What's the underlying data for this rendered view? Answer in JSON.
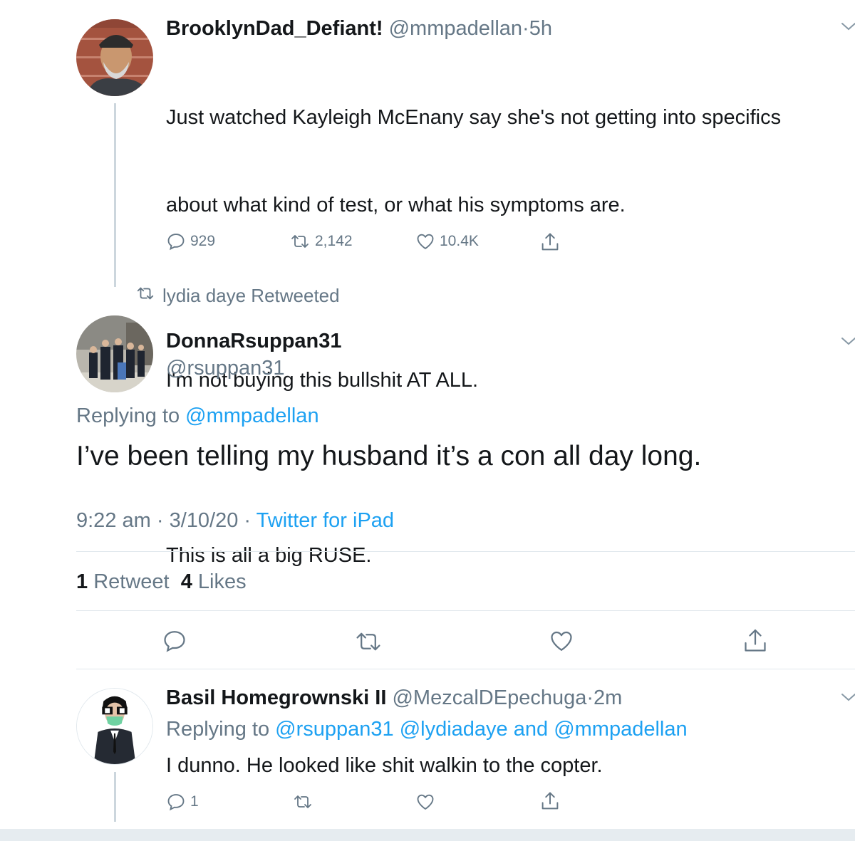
{
  "tweet1": {
    "display_name": "BrooklynDad_Defiant!",
    "handle": "@mmpadellan",
    "sep": "·",
    "time": "5h",
    "lines": [
      "Just watched Kayleigh McEnany say she's not getting into specifics",
      "about what kind of test, or what his symptoms are.",
      "I'm not buying this bullshit AT ALL.",
      "This is all a big RUSE."
    ],
    "replies": "929",
    "retweets": "2,142",
    "likes": "10.4K"
  },
  "retweet_context": {
    "text": "lydia daye Retweeted",
    "icon": "retweet-icon"
  },
  "main_tweet": {
    "display_name": "DonnaRsuppan31",
    "handle": "@rsuppan31",
    "replying_prefix": "Replying to",
    "replying_to": "@mmpadellan",
    "text": "I’ve been telling my husband it’s a con all day long.",
    "time": "9:22 am",
    "sep1": "·",
    "date": "3/10/20",
    "sep2": "·",
    "source": "Twitter for iPad",
    "retweet_count": "1",
    "retweet_label": "Retweet",
    "like_count": "4",
    "like_label": "Likes"
  },
  "reply_tweet": {
    "display_name": "Basil Homegrownski II",
    "handle": "@MezcalDEpechuga",
    "sep": "·",
    "time": "2m",
    "replying_prefix": "Replying to",
    "mention1": "@rsuppan31",
    "mention2": "@lydiadaye",
    "and_word": "and",
    "mention3": "@mmpadellan",
    "text": "I dunno. He looked like shit walkin to the copter.",
    "replies": "1"
  },
  "colors": {
    "accent": "#1da1f2",
    "muted": "#657786",
    "text": "#14171a",
    "divider": "#e1e8ed"
  }
}
